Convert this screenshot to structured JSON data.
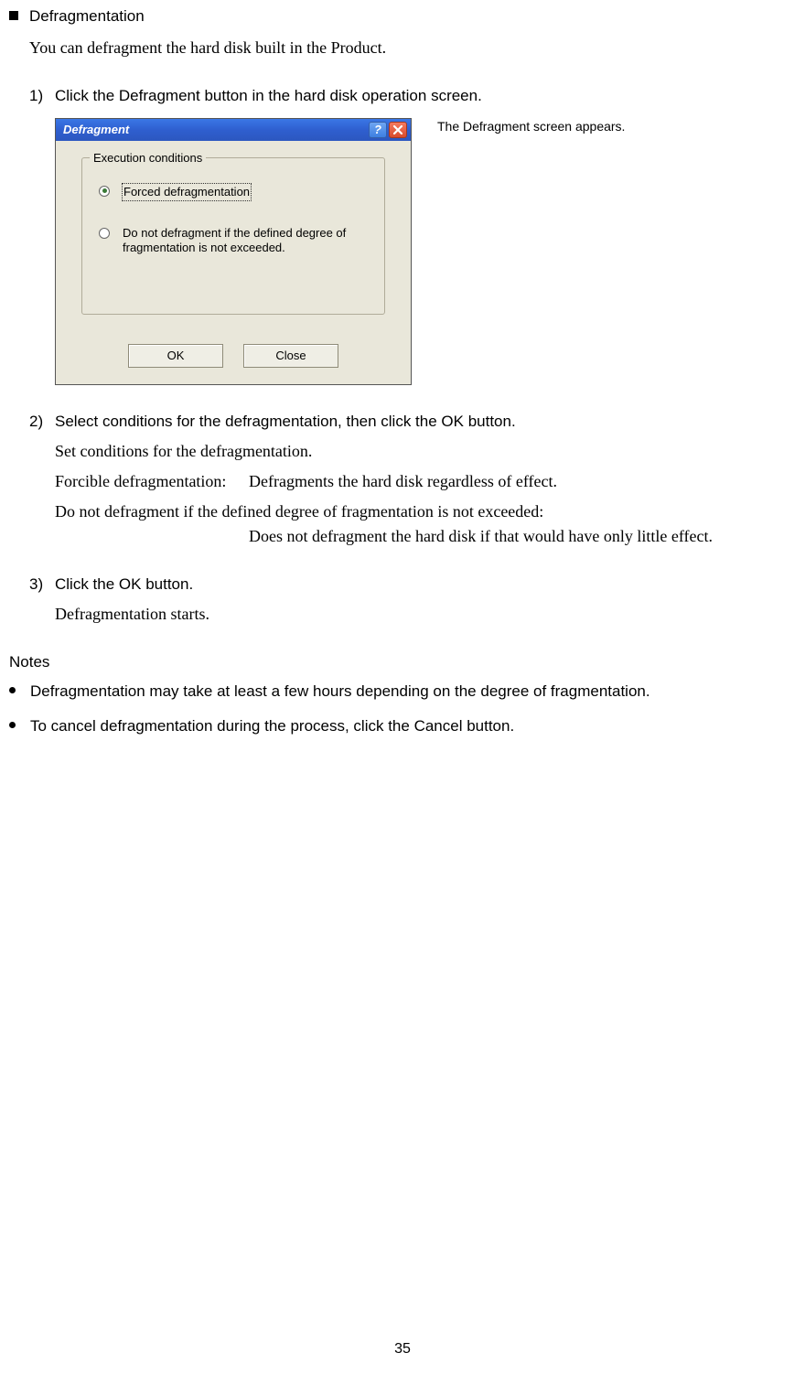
{
  "section": {
    "title": "Defragmentation",
    "intro": "You can defragment the hard disk built in the Product."
  },
  "steps": [
    {
      "num": "1)",
      "text": "Click the Defragment button in the hard disk operation screen.",
      "caption": "The Defragment screen appears."
    },
    {
      "num": "2)",
      "text": "Select conditions for the defragmentation, then click the OK button.",
      "sublines": {
        "set": "Set conditions for the defragmentation.",
        "forcible_label": "Forcible defragmentation:",
        "forcible_desc": "Defragments the hard disk regardless of effect.",
        "dnd_label": "Do not defragment if the defined degree of fragmentation is not exceeded:",
        "dnd_desc": "Does not defragment the hard disk if that would have only little effect."
      }
    },
    {
      "num": "3)",
      "text": "Click the OK button.",
      "sub": "Defragmentation starts."
    }
  ],
  "dialog": {
    "title": "Defragment",
    "help": "?",
    "group_legend": "Execution conditions",
    "opt1": "Forced defragmentation",
    "opt2": "Do not defragment if the defined degree of fragmentation is not exceeded.",
    "ok": "OK",
    "close": "Close"
  },
  "notes": {
    "title": "Notes",
    "items": [
      "Defragmentation may take at least a few hours depending on the degree of fragmentation.",
      "To cancel defragmentation during the process, click the Cancel button."
    ]
  },
  "pagenum": "35"
}
